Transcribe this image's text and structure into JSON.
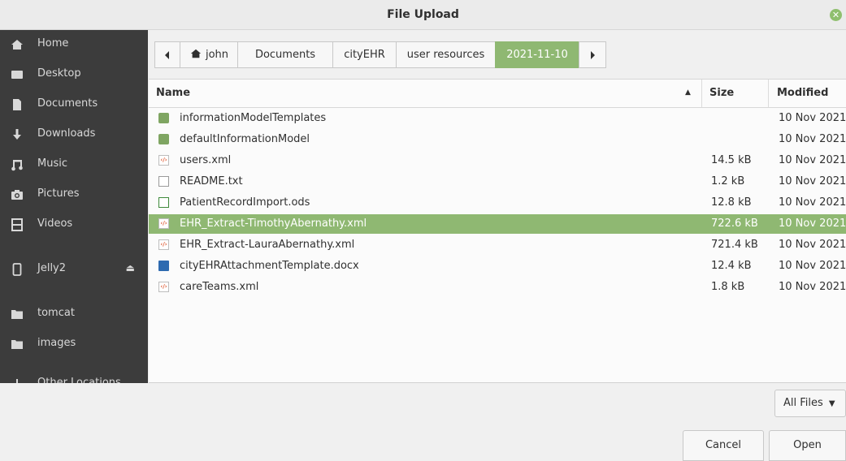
{
  "window": {
    "title": "File Upload"
  },
  "colors": {
    "accent": "#8fb872",
    "sidebar_bg": "#3c3c3c"
  },
  "sidebar": {
    "items": [
      {
        "label": "Home",
        "icon": "home-icon"
      },
      {
        "label": "Desktop",
        "icon": "desktop-icon"
      },
      {
        "label": "Documents",
        "icon": "document-icon"
      },
      {
        "label": "Downloads",
        "icon": "download-icon"
      },
      {
        "label": "Music",
        "icon": "music-icon"
      },
      {
        "label": "Pictures",
        "icon": "camera-icon"
      },
      {
        "label": "Videos",
        "icon": "film-icon"
      },
      {
        "label": "Jelly2",
        "icon": "phone-icon",
        "eject": "eject-icon"
      },
      {
        "label": "tomcat",
        "icon": "folder-icon"
      },
      {
        "label": "images",
        "icon": "folder-icon"
      },
      {
        "label": "Other Locations",
        "icon": "plus-icon"
      }
    ]
  },
  "pathbar": {
    "back_icon": "chevron-left-icon",
    "forward_icon": "chevron-right-icon",
    "segments": [
      {
        "label": "john",
        "icon": "home-icon"
      },
      {
        "label": "Documents"
      },
      {
        "label": "cityEHR"
      },
      {
        "label": "user resources"
      },
      {
        "label": "2021-11-10",
        "active": true
      }
    ]
  },
  "columns": {
    "name": "Name",
    "size": "Size",
    "modified": "Modified"
  },
  "files": [
    {
      "name": "informationModelTemplates",
      "size": "",
      "modified": "10 Nov 2021",
      "type": "folder"
    },
    {
      "name": "defaultInformationModel",
      "size": "",
      "modified": "10 Nov 2021",
      "type": "folder"
    },
    {
      "name": "users.xml",
      "size": "14.5 kB",
      "modified": "10 Nov 2021",
      "type": "xml"
    },
    {
      "name": "README.txt",
      "size": "1.2 kB",
      "modified": "10 Nov 2021",
      "type": "txt"
    },
    {
      "name": "PatientRecordImport.ods",
      "size": "12.8 kB",
      "modified": "10 Nov 2021",
      "type": "ods"
    },
    {
      "name": "EHR_Extract-TimothyAbernathy.xml",
      "size": "722.6 kB",
      "modified": "10 Nov 2021",
      "type": "xml",
      "selected": true
    },
    {
      "name": "EHR_Extract-LauraAbernathy.xml",
      "size": "721.4 kB",
      "modified": "10 Nov 2021",
      "type": "xml"
    },
    {
      "name": "cityEHRAttachmentTemplate.docx",
      "size": "12.4 kB",
      "modified": "10 Nov 2021",
      "type": "docx"
    },
    {
      "name": "careTeams.xml",
      "size": "1.8 kB",
      "modified": "10 Nov 2021",
      "type": "xml"
    }
  ],
  "filter": {
    "label": "All Files"
  },
  "buttons": {
    "cancel": "Cancel",
    "open": "Open"
  }
}
